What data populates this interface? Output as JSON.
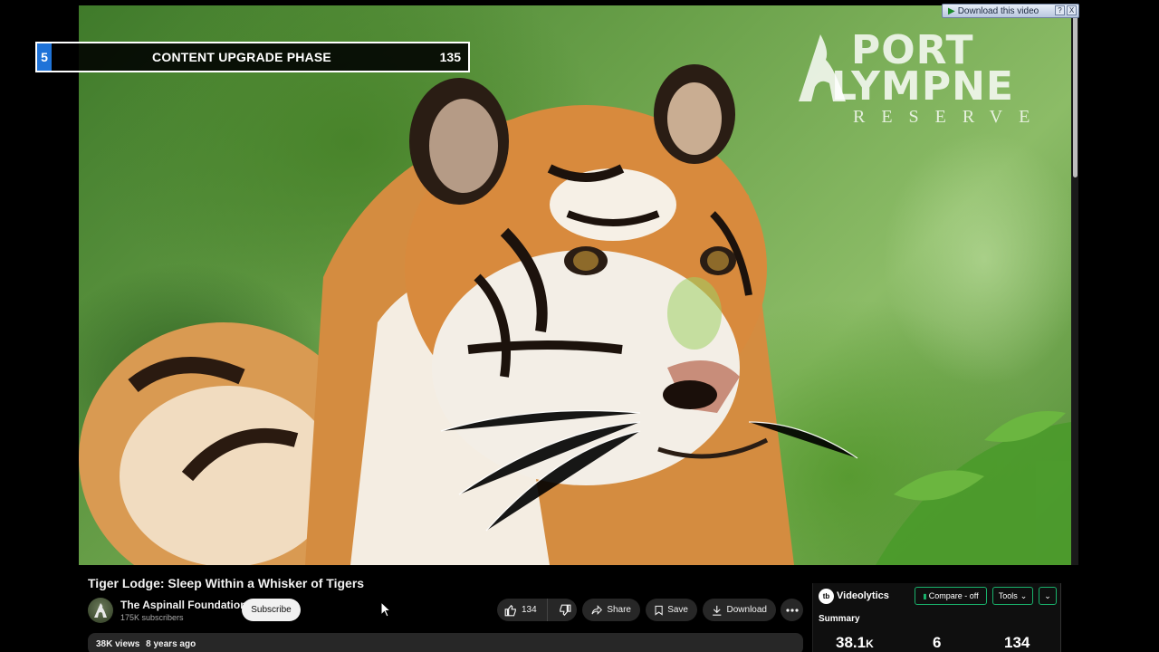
{
  "video": {
    "title": "Tiger Lodge: Sleep Within a Whisker of Tigers"
  },
  "overlay_banner": {
    "number": "5",
    "title": "CONTENT UPGRADE PHASE",
    "count": "135"
  },
  "watermark_logo": {
    "line1": "PORT",
    "line2": "LYMPNE",
    "line3": "RESERVE"
  },
  "download_this_video": {
    "label": "Download this video",
    "help": "?",
    "close": "X"
  },
  "channel": {
    "name": "The Aspinall Foundation",
    "subscribers": "175K subscribers",
    "subscribe_label": "Subscribe"
  },
  "actions": {
    "like_count": "134",
    "share_label": "Share",
    "save_label": "Save",
    "download_label": "Download"
  },
  "meta": {
    "views": "38K views",
    "age": "8 years ago"
  },
  "videolytics": {
    "logo": "tb",
    "title": "Videolytics",
    "compare_label": "Compare - off",
    "tools_label": "Tools",
    "summary_label": "Summary",
    "views_value": "38.1",
    "views_suffix": "K",
    "dislikes_value": "6",
    "likes_value": "134",
    "accent_color": "#19b16b"
  },
  "icons": [
    "like-icon",
    "dislike-icon",
    "share-icon",
    "save-icon",
    "download-icon",
    "more-icon",
    "chevron-down-icon",
    "play-icon",
    "cursor-icon"
  ]
}
